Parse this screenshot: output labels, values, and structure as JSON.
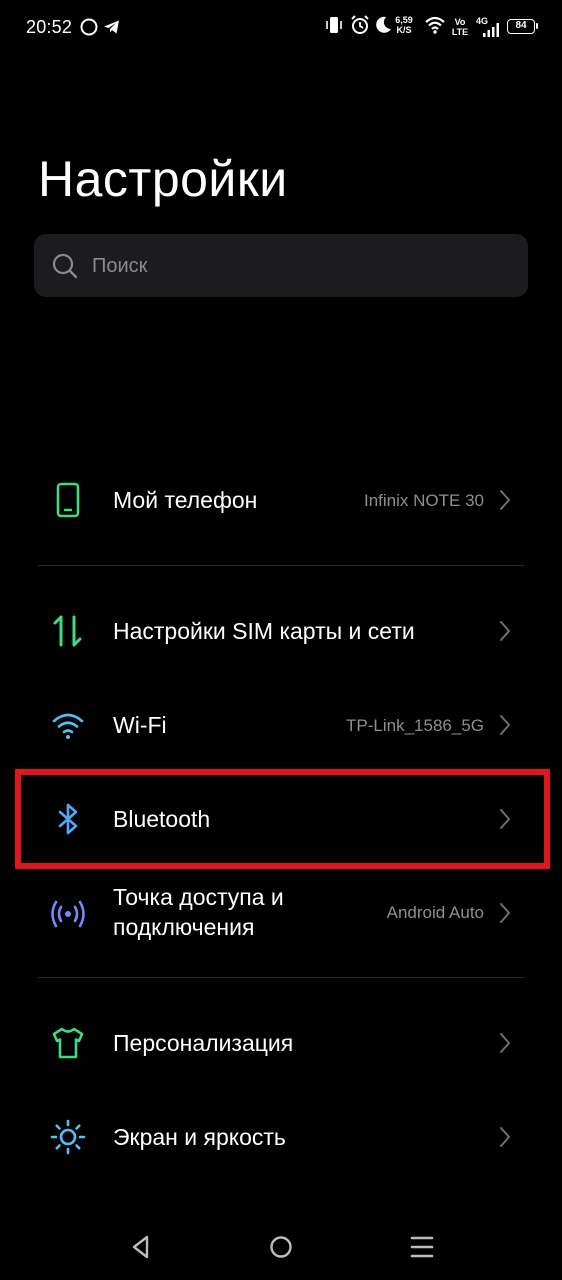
{
  "status_bar": {
    "time": "20:52",
    "speed_value": "6,59",
    "speed_unit": "K/S",
    "volte_top": "Vo",
    "volte_bottom": "LTE",
    "network": "4G",
    "battery": "84"
  },
  "header": {
    "title": "Настройки"
  },
  "search": {
    "placeholder": "Поиск"
  },
  "settings": [
    {
      "label": "Мой телефон",
      "value": "Infinix NOTE 30",
      "icon": "phone-icon",
      "color": "#3ddc84"
    },
    {
      "label": "Настройки SIM карты и сети",
      "value": "",
      "icon": "sim-network-icon",
      "color": "#3ddc84"
    },
    {
      "label": "Wi-Fi",
      "value": "TP-Link_1586_5G",
      "icon": "wifi-icon",
      "color": "#4fc3f7"
    },
    {
      "label": "Bluetooth",
      "value": "",
      "icon": "bluetooth-icon",
      "color": "#4fa8ff"
    },
    {
      "label_line1": "Точка доступа и",
      "label_line2": "подключения",
      "value": "Android Auto",
      "icon": "hotspot-icon",
      "color": "#6f8cff"
    },
    {
      "label": "Персонализация",
      "value": "",
      "icon": "tshirt-icon",
      "color": "#3ddc84"
    },
    {
      "label": "Экран и яркость",
      "value": "",
      "icon": "brightness-icon",
      "color": "#4fc3f7"
    }
  ],
  "colors": {
    "background": "#000000",
    "highlight": "#e0151e",
    "secondary_text": "#8e8e93"
  }
}
